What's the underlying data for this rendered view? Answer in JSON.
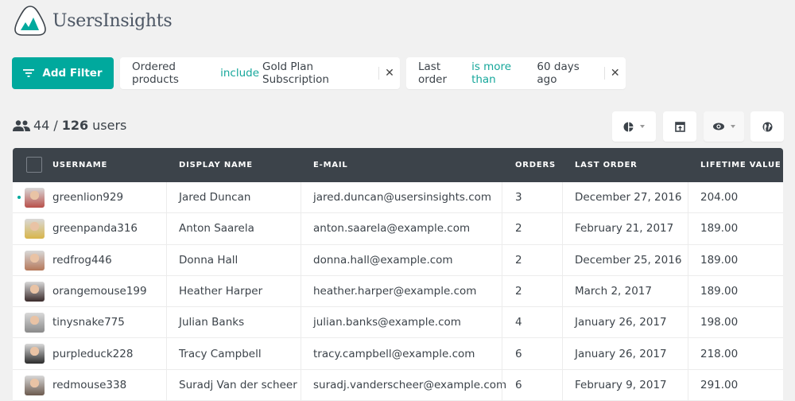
{
  "app": {
    "name": "UsersInsights",
    "accent": "#00a99d",
    "header_bg": "#3c434a"
  },
  "filters": {
    "add_label": "Add Filter",
    "items": [
      {
        "field": "Ordered products",
        "operator": "include",
        "value": "Gold Plan Subscription",
        "remove_icon": "close-icon"
      },
      {
        "field": "Last order",
        "operator": "is more than",
        "value": "60 days ago",
        "remove_icon": "close-icon"
      }
    ]
  },
  "summary": {
    "shown": "44",
    "separator": "/",
    "total": "126",
    "unit": "users"
  },
  "toolbar": [
    {
      "name": "segments-button",
      "icon": "pie-chart-icon",
      "dropdown": true
    },
    {
      "name": "export-button",
      "icon": "export-icon",
      "dropdown": false
    },
    {
      "name": "columns-visibility-button",
      "icon": "eye-icon",
      "dropdown": true
    },
    {
      "name": "map-view-button",
      "icon": "globe-icon",
      "dropdown": false
    }
  ],
  "table": {
    "columns": [
      "USERNAME",
      "DISPLAY NAME",
      "E-MAIL",
      "ORDERS",
      "LAST ORDER",
      "LIFETIME VALUE"
    ],
    "rows": [
      {
        "username": "greenlion929",
        "display_name": "Jared Duncan",
        "email": "jared.duncan@usersinsights.com",
        "orders": "3",
        "last_order": "December 27, 2016",
        "lifetime_value": "204.00",
        "online": true,
        "avatar_color": "#b9504a"
      },
      {
        "username": "greenpanda316",
        "display_name": "Anton Saarela",
        "email": "anton.saarela@example.com",
        "orders": "2",
        "last_order": "February 21, 2017",
        "lifetime_value": "189.00",
        "online": false,
        "avatar_color": "#d8b54a"
      },
      {
        "username": "redfrog446",
        "display_name": "Donna Hall",
        "email": "donna.hall@example.com",
        "orders": "2",
        "last_order": "December 25, 2016",
        "lifetime_value": "189.00",
        "online": false,
        "avatar_color": "#b5785a"
      },
      {
        "username": "orangemouse199",
        "display_name": "Heather Harper",
        "email": "heather.harper@example.com",
        "orders": "2",
        "last_order": "March 2, 2017",
        "lifetime_value": "189.00",
        "online": false,
        "avatar_color": "#3a2a2a"
      },
      {
        "username": "tinysnake775",
        "display_name": "Julian Banks",
        "email": "julian.banks@example.com",
        "orders": "4",
        "last_order": "January 26, 2017",
        "lifetime_value": "198.00",
        "online": false,
        "avatar_color": "#8a8a8a"
      },
      {
        "username": "purpleduck228",
        "display_name": "Tracy Campbell",
        "email": "tracy.campbell@example.com",
        "orders": "6",
        "last_order": "January 26, 2017",
        "lifetime_value": "218.00",
        "online": false,
        "avatar_color": "#2b2b2b"
      },
      {
        "username": "redmouse338",
        "display_name": "Suradj Van der scheer",
        "email": "suradj.vanderscheer@example.com",
        "orders": "6",
        "last_order": "February 9, 2017",
        "lifetime_value": "291.00",
        "online": false,
        "avatar_color": "#6b5a4e"
      }
    ]
  }
}
